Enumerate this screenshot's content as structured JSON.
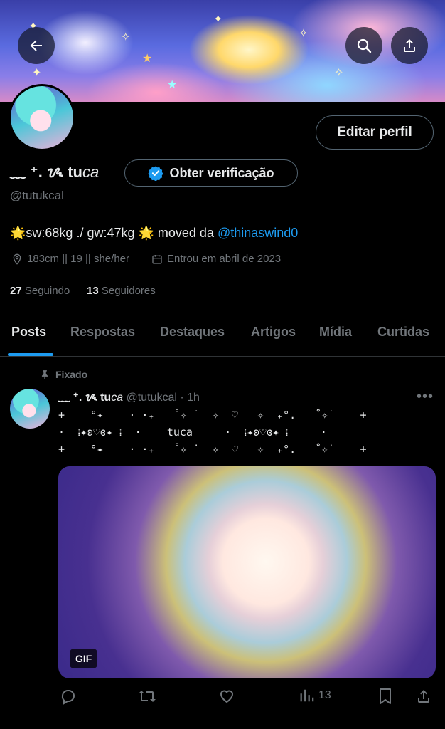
{
  "header": {
    "back_icon": "arrow-left-icon",
    "search_icon": "search-icon",
    "share_icon": "share-icon"
  },
  "profile": {
    "edit_label": "Editar perfil",
    "display_name_prefix": "﹏ ⁺. ᝰ tu",
    "display_name_suffix": "ca",
    "verify_label": "Obter verificação",
    "handle": "@tutukcal",
    "bio_text": "🌟sw:68kg ./ gw:47kg 🌟 moved da ",
    "bio_link": "@thinaswind0",
    "location": "183cm || 19 || she/her",
    "joined": "Entrou em abril de 2023",
    "following_count": "27",
    "following_label": "Seguindo",
    "followers_count": "13",
    "followers_label": "Seguidores"
  },
  "tabs": [
    {
      "label": "Posts"
    },
    {
      "label": "Respostas"
    },
    {
      "label": "Destaques"
    },
    {
      "label": "Artigos"
    },
    {
      "label": "Mídia"
    },
    {
      "label": "Curtidas"
    }
  ],
  "tweet": {
    "pinned_label": "Fixado",
    "name_prefix": "﹏ ⁺. ᝰ tu",
    "name_suffix": "ca",
    "handle_time": " @tutukcal · 1h",
    "line1": "+    °✦    · ·₊   ˚✧ ˙  ✧  ♡   ✧  ₊°.   ˚✧˙    +",
    "line2": "·  ⁞✦ʚ♡ɞ✦ ⁞  ·    tuca     ·  ⁞✦ʚ♡ɞ✦ ⁞     ·",
    "line3": "+    °✦    · ·₊   ˚✧ ˙  ✧  ♡   ✧  ₊°.   ˚✧˙    +",
    "gif_label": "GIF",
    "views": "13"
  },
  "colors": {
    "accent": "#1d9bf0",
    "muted": "#71767b",
    "text": "#e7e9ea",
    "bg": "#000000"
  }
}
